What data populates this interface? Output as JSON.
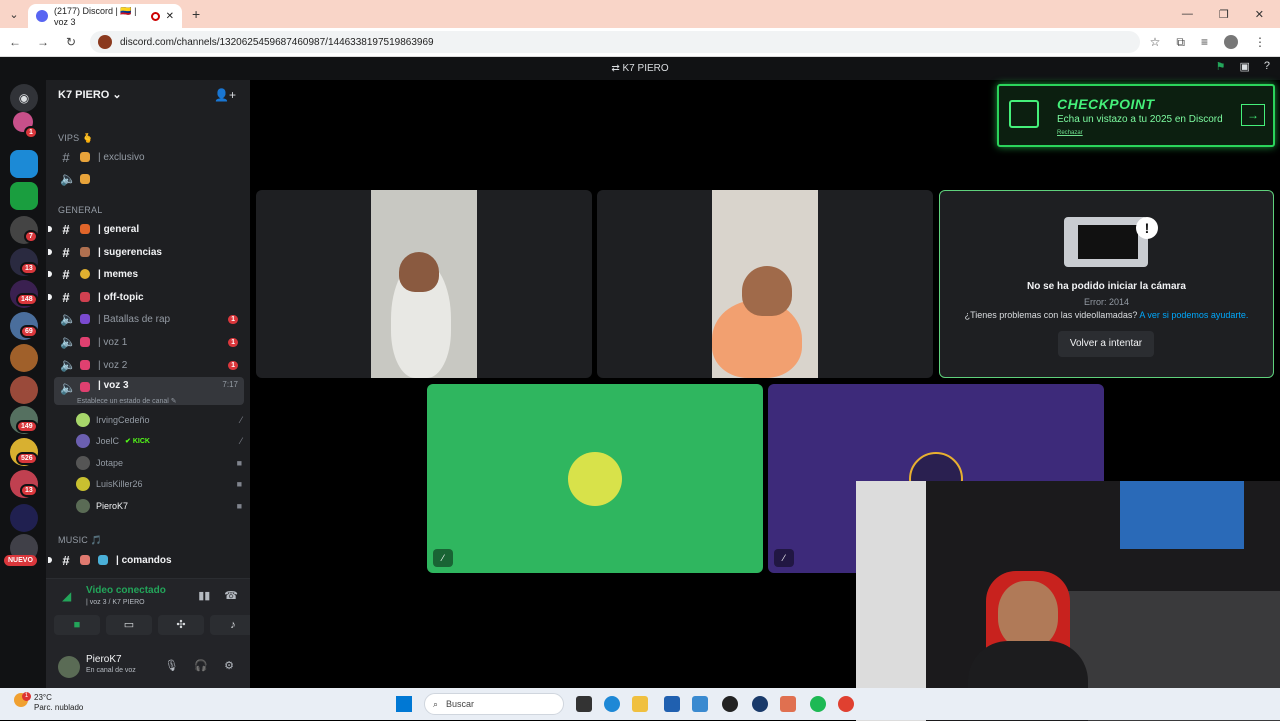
{
  "browser": {
    "tab_title": "(2177) Discord | 🇨🇴 | voz 3",
    "url": "discord.com/channels/1320625459687460987/1446338197519863969"
  },
  "topbar": {
    "title": "K7 PIERO"
  },
  "server": {
    "name": "K7 PIERO"
  },
  "rail_badges": [
    "1",
    "7",
    "13",
    "148",
    "69",
    "149",
    "526",
    "13"
  ],
  "rail_new": "NUEVO",
  "categories": {
    "vips": "VIPS 🫰",
    "general": "GENERAL",
    "music": "MUSIC 🎵"
  },
  "channels": {
    "exclusivo": "| exclusivo",
    "general": "| general",
    "sugerencias": "| sugerencias",
    "memes": "| memes",
    "offtopic": "| off-topic",
    "batallas": "| Batallas de rap",
    "voz1": "| voz 1",
    "voz2": "| voz 2",
    "voz3": "| voz 3",
    "voz3_time": "7:17",
    "voz3_status": "Establece un estado de canal",
    "comandos": "| comandos",
    "badge_1": "1"
  },
  "members": [
    {
      "name": "IrvingCedeño"
    },
    {
      "name": "JoelC",
      "tag": "KICK"
    },
    {
      "name": "Jotape"
    },
    {
      "name": "LuisKiller26"
    },
    {
      "name": "PieroK7"
    }
  ],
  "voice_panel": {
    "status": "Video conectado",
    "location": "| voz 3 / K7 PIERO"
  },
  "user_panel": {
    "name": "PieroK7",
    "status": "En canal de voz"
  },
  "checkpoint": {
    "title": "CHECKPOINT",
    "subtitle": "Echa un vistazo a tu 2025 en Discord",
    "dismiss": "Rechazar"
  },
  "camera_error": {
    "title": "No se ha podido iniciar la cámara",
    "code": "Error: 2014",
    "help_text": "¿Tienes problemas con las videollamadas?",
    "help_link": "A ver si podemos ayudarte.",
    "retry": "Volver a intentar"
  },
  "taskbar": {
    "temp": "23°C",
    "weather": "Parc. nublado",
    "search_placeholder": "Buscar",
    "notif": "1"
  },
  "colors": {
    "discord_green": "#23a55a",
    "tile_green": "#2fb65f",
    "tile_purple": "#3d2a7a",
    "badge_red": "#da373c",
    "checkpoint_green": "#45f07a"
  }
}
